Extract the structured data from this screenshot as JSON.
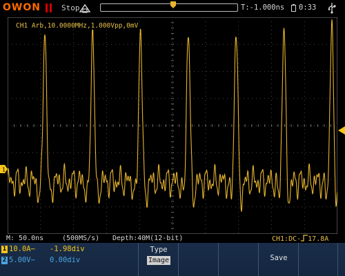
{
  "brand": "OWON",
  "run_state": "Stop",
  "trigger_time": "T:-1.000ns",
  "clock": "0:33",
  "channel_info": "CH1 Arb,10.0000MHz,1.000Vpp,0mV",
  "status": {
    "timebase": "M: 50.0ns",
    "sample_rate": "(500MS/s)",
    "depth": "Depth:40M(12-bit)",
    "trigger": "CH1:DC-",
    "trigger_level": "17.8A"
  },
  "channels": [
    {
      "num": "1",
      "scale": "10.0A~",
      "position": "-1.98div",
      "color": "#f5c518"
    },
    {
      "num": "2",
      "scale": "5.00V~",
      "position": "0.00div",
      "color": "#4aa3e0"
    }
  ],
  "menu": {
    "type_label": "Type",
    "type_value": "Image",
    "save_label": "Save"
  },
  "colors": {
    "ch1_trace": "#e8b52e",
    "grid": "#6a6a6a",
    "brand": "#ff6a00",
    "panel": "#1a2d48"
  },
  "waveform": {
    "pulse_count": 7,
    "description_fraction_peak": 0.88
  }
}
